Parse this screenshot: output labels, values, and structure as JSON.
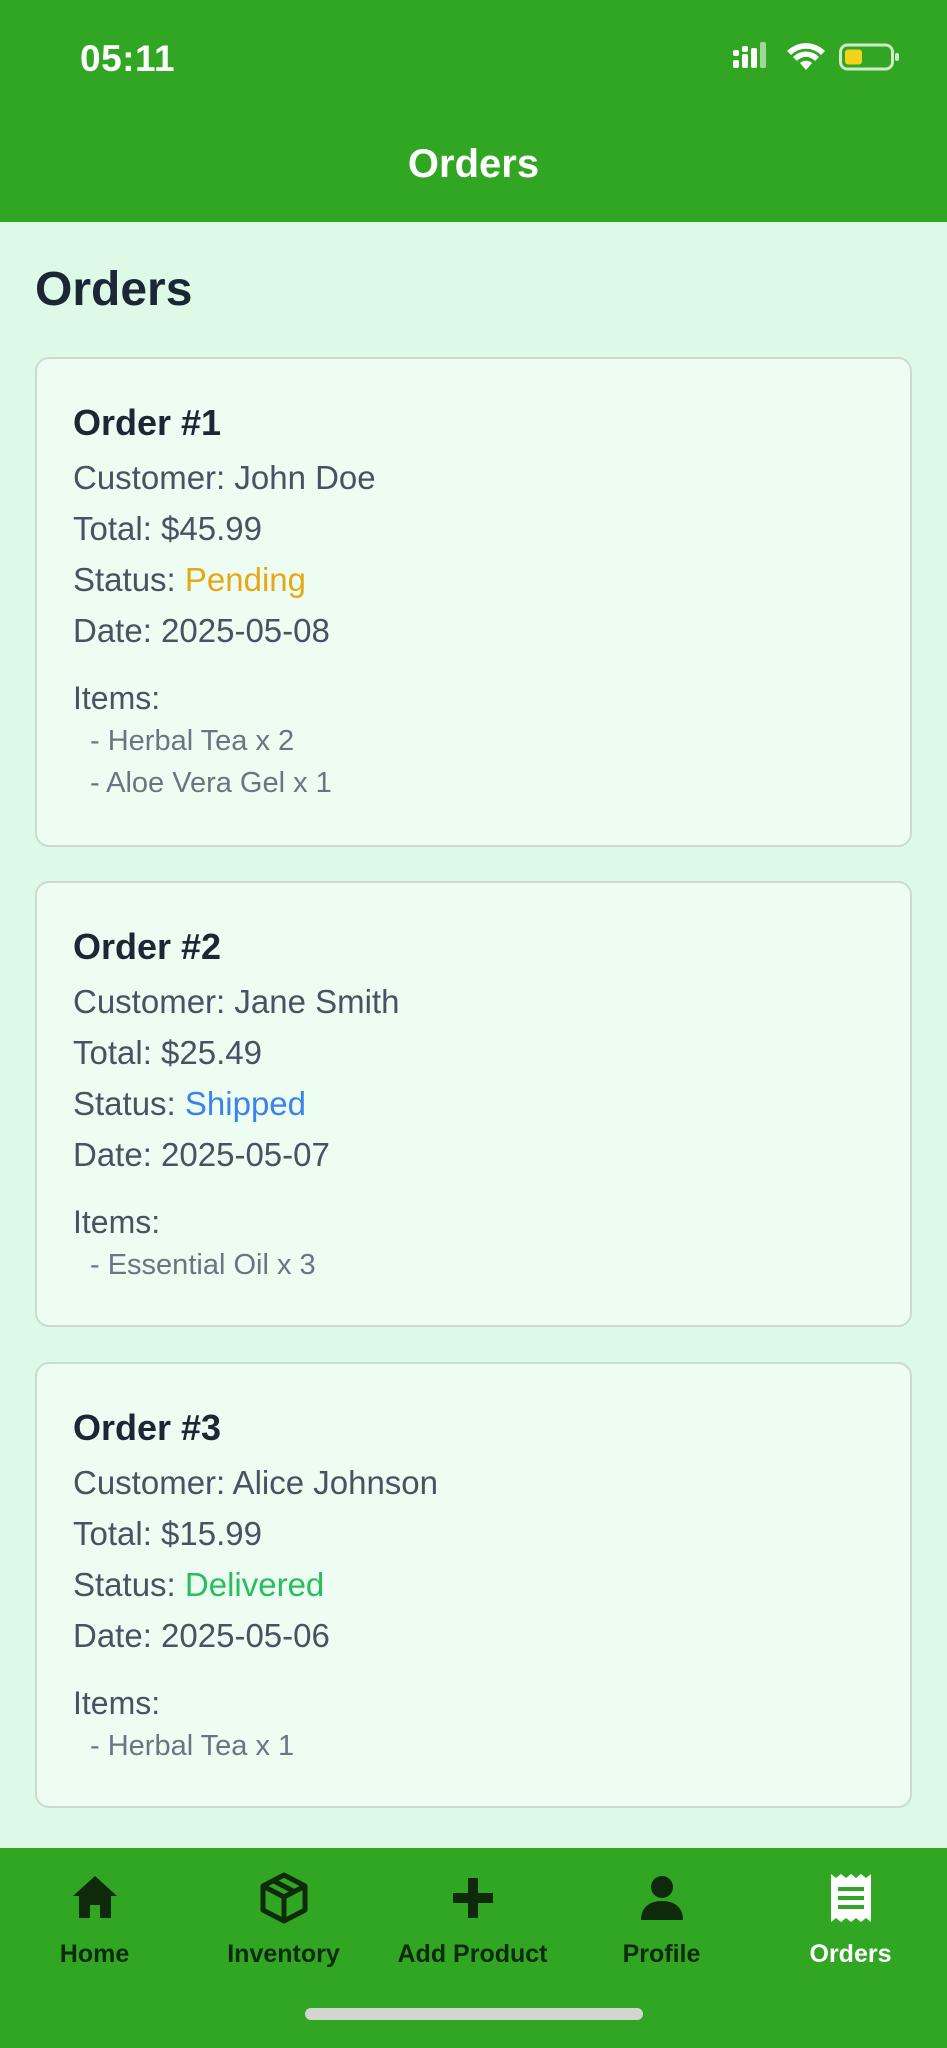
{
  "status_bar": {
    "time": "05:11",
    "icons": [
      "signal-icon",
      "wifi-icon",
      "battery-icon"
    ]
  },
  "header": {
    "title": "Orders"
  },
  "page": {
    "title": "Orders"
  },
  "colors": {
    "brand": "#30a622",
    "background": "#dcfae6",
    "card": "#edfdf2",
    "pending": "#e5a916",
    "shipped": "#3c82ea",
    "delivered": "#28be5e"
  },
  "orders": [
    {
      "title": "Order #1",
      "customer_label": "Customer: John Doe",
      "total_label": "Total: $45.99",
      "status_prefix": "Status: ",
      "status": "Pending",
      "date_label": "Date: 2025-05-08",
      "items_label": "Items:",
      "items": [
        "- Herbal Tea x 2",
        "- Aloe Vera Gel x 1"
      ]
    },
    {
      "title": "Order #2",
      "customer_label": "Customer: Jane Smith",
      "total_label": "Total: $25.49",
      "status_prefix": "Status: ",
      "status": "Shipped",
      "date_label": "Date: 2025-05-07",
      "items_label": "Items:",
      "items": [
        "- Essential Oil x 3"
      ]
    },
    {
      "title": "Order #3",
      "customer_label": "Customer: Alice Johnson",
      "total_label": "Total: $15.99",
      "status_prefix": "Status: ",
      "status": "Delivered",
      "date_label": "Date: 2025-05-06",
      "items_label": "Items:",
      "items": [
        "- Herbal Tea x 1"
      ]
    }
  ],
  "nav": {
    "items": [
      {
        "label": "Home",
        "icon": "home-icon"
      },
      {
        "label": "Inventory",
        "icon": "box-icon"
      },
      {
        "label": "Add Product",
        "icon": "plus-icon"
      },
      {
        "label": "Profile",
        "icon": "person-icon"
      },
      {
        "label": "Orders",
        "icon": "receipt-icon",
        "active": true
      }
    ]
  }
}
